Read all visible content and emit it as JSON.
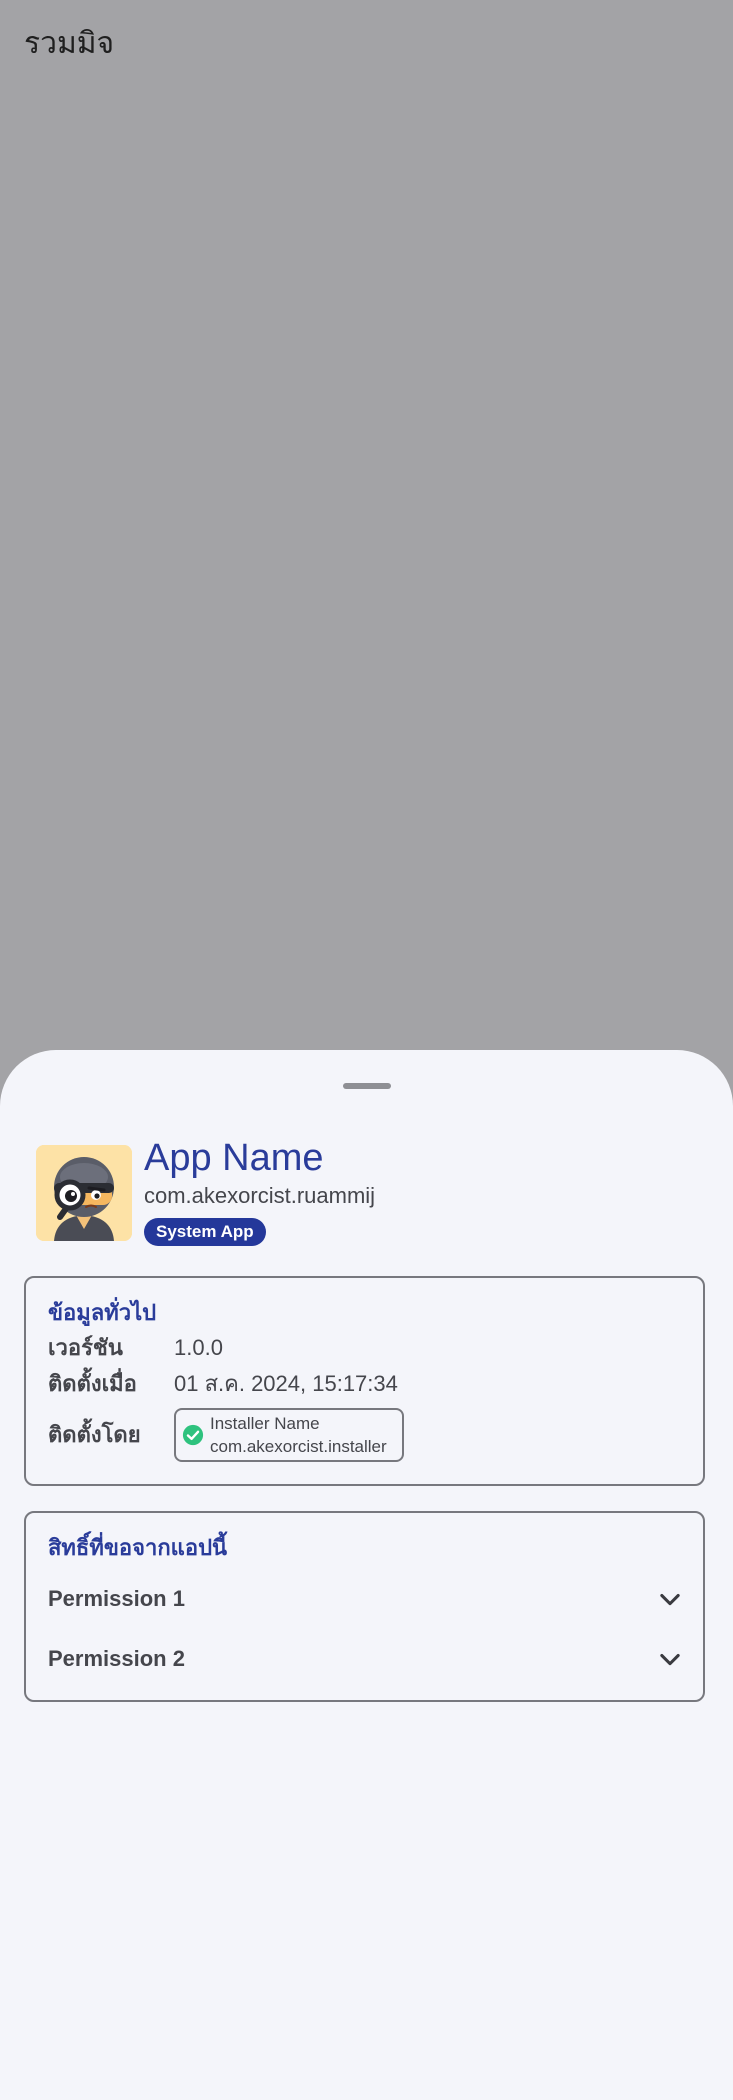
{
  "background": {
    "title": "รวมมิจ"
  },
  "app": {
    "name": "App Name",
    "package": "com.akexorcist.ruammij",
    "badge": "System App",
    "icon": "ninja-detective-avatar-icon"
  },
  "general_info": {
    "title": "ข้อมูลทั่วไป",
    "version_label": "เวอร์ชัน",
    "version_value": "1.0.0",
    "installed_at_label": "ติดตั้งเมื่อ",
    "installed_at_value": "01 ส.ค. 2024, 15:17:34",
    "installed_by_label": "ติดตั้งโดย",
    "installer": {
      "name": "Installer Name",
      "package": "com.akexorcist.installer",
      "verified_icon": "check-circle-icon"
    }
  },
  "permissions": {
    "title": "สิทธิ์ที่ขอจากแอปนี้",
    "items": [
      {
        "label": "Permission 1",
        "icon": "chevron-down-icon"
      },
      {
        "label": "Permission 2",
        "icon": "chevron-down-icon"
      }
    ]
  },
  "colors": {
    "scrim": "#a3a3a6",
    "sheet": "#f4f5fa",
    "primary": "#2a3c9a",
    "badge": "#24389a",
    "verified": "#2ec27e",
    "outline": "#77787e",
    "text": "#45464c"
  }
}
